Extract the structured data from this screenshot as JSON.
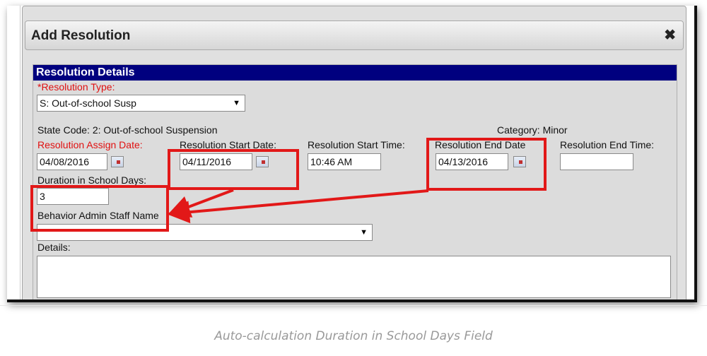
{
  "dialog": {
    "title": "Add Resolution",
    "close_icon": "close-icon"
  },
  "section": {
    "header": "Resolution Details"
  },
  "form": {
    "resolution_type_label": "*Resolution Type:",
    "resolution_type_value": "S: Out-of-school Susp",
    "state_code": "State Code: 2: Out-of-school Suspension",
    "category": "Category: Minor",
    "assign_date_label": "Resolution Assign Date:",
    "assign_date_value": "04/08/2016",
    "start_date_label": "Resolution Start Date:",
    "start_date_value": "04/11/2016",
    "start_time_label": "Resolution Start Time:",
    "start_time_value": "10:46 AM",
    "end_date_label": "Resolution End Date",
    "end_date_value": "04/13/2016",
    "end_time_label": "Resolution End Time:",
    "end_time_value": "",
    "duration_label": "Duration in School Days:",
    "duration_value": "3",
    "staff_label": "Behavior Admin Staff Name",
    "staff_value": "",
    "details_label": "Details:",
    "details_value": ""
  },
  "annotation_color": "#e21818",
  "caption": "Auto-calculation Duration in School Days Field"
}
